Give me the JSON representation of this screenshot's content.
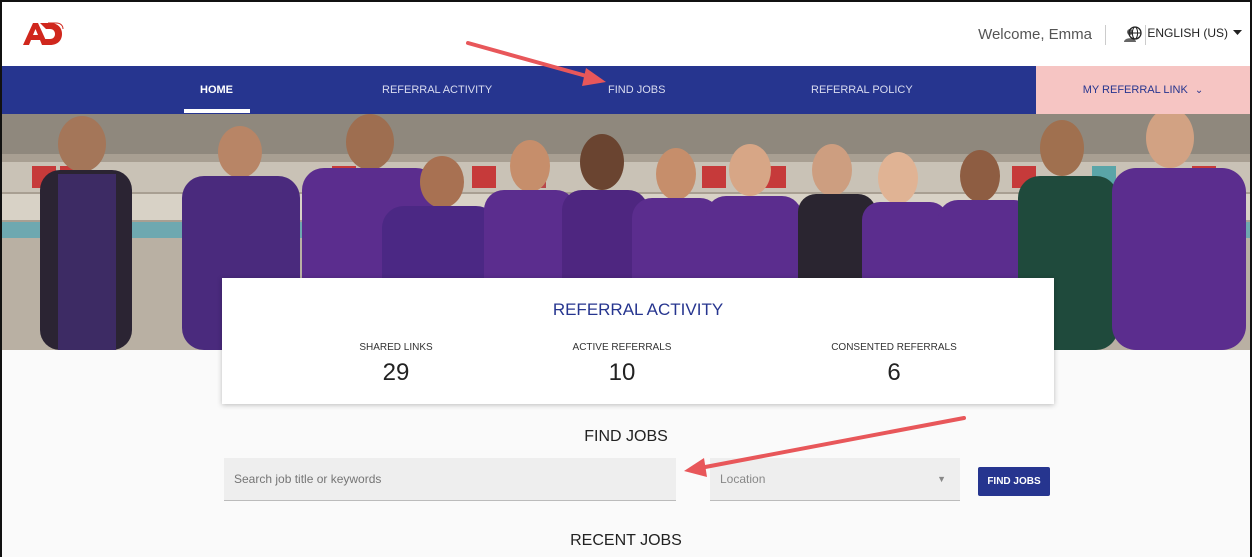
{
  "header": {
    "welcome": "Welcome, Emma",
    "language": "ENGLISH (US)",
    "icons": [
      "adp-logo",
      "user-icon",
      "globe-icon",
      "caret-down-icon"
    ]
  },
  "nav": {
    "items": [
      {
        "label": "HOME",
        "active": true
      },
      {
        "label": "REFERRAL ACTIVITY",
        "active": false
      },
      {
        "label": "FIND JOBS",
        "active": false
      },
      {
        "label": "REFERRAL POLICY",
        "active": false
      }
    ],
    "my_referral_link": "MY REFERRAL LINK"
  },
  "referral_activity": {
    "title": "REFERRAL ACTIVITY",
    "stats": [
      {
        "label": "SHARED LINKS",
        "value": "29"
      },
      {
        "label": "ACTIVE REFERRALS",
        "value": "10"
      },
      {
        "label": "CONSENTED REFERRALS",
        "value": "6"
      }
    ]
  },
  "find_jobs": {
    "title": "FIND JOBS",
    "search_placeholder": "Search job title or keywords",
    "location_placeholder": "Location",
    "button_label": "FIND JOBS"
  },
  "recent_jobs": {
    "title": "RECENT JOBS"
  },
  "colors": {
    "nav_blue": "#26358f",
    "referral_link_bg": "#f6c5c3",
    "adp_red": "#d0271d",
    "annotation_arrow": "#e8575a",
    "shirt_purple": "#5b2d8e"
  }
}
